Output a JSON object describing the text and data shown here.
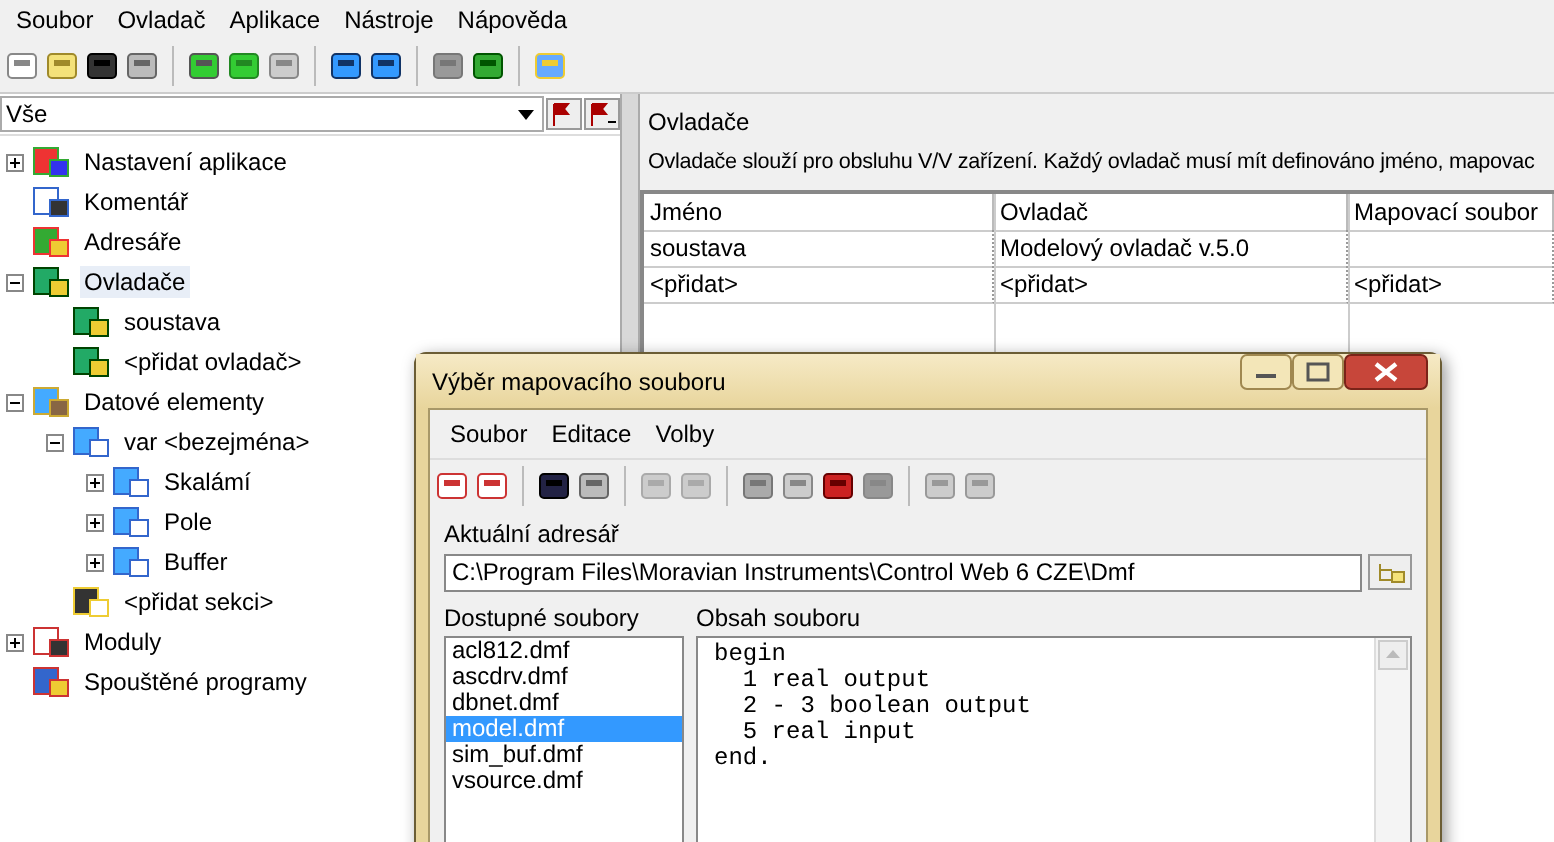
{
  "menu": [
    {
      "label": "Soubor"
    },
    {
      "label": "Ovladač"
    },
    {
      "label": "Aplikace"
    },
    {
      "label": "Nástroje"
    },
    {
      "label": "Nápověda"
    }
  ],
  "filter": {
    "value": "Vše"
  },
  "tree": [
    {
      "label": "Nastavení aplikace",
      "kind": "settings",
      "expanded": false,
      "selected": false
    },
    {
      "label": "Komentář",
      "kind": "comment",
      "selected": false
    },
    {
      "label": "Adresáře",
      "kind": "directories",
      "selected": false
    },
    {
      "label": "Ovladače",
      "kind": "drivers",
      "expanded": true,
      "selected": true,
      "children": [
        {
          "label": "soustava",
          "kind": "drivers",
          "selected": false
        },
        {
          "label": "<přidat ovladač>",
          "kind": "drivers",
          "selected": false
        }
      ]
    },
    {
      "label": "Datové elementy",
      "kind": "data",
      "expanded": true,
      "selected": false,
      "children": [
        {
          "label": "var <bezejména>",
          "kind": "variable",
          "expanded": true,
          "selected": false,
          "children": [
            {
              "label": "Skalámí",
              "kind": "element",
              "expanded": false,
              "selected": false
            },
            {
              "label": "Pole",
              "kind": "element",
              "expanded": false,
              "selected": false
            },
            {
              "label": "Buffer",
              "kind": "element",
              "expanded": false,
              "selected": false
            }
          ]
        },
        {
          "label": "<přidat sekci>",
          "kind": "section",
          "selected": false
        }
      ]
    },
    {
      "label": "Moduly",
      "kind": "modules",
      "expanded": false,
      "selected": false
    },
    {
      "label": "Spouštěné programy",
      "kind": "programs",
      "selected": false
    }
  ],
  "panel": {
    "title": "Ovladače",
    "description": "Ovladače slouží pro obsluhu V/V zařízení. Každý ovladač musí mít definováno jméno, mapovac"
  },
  "table": {
    "columns": [
      "Jméno",
      "Ovladač",
      "Mapovací soubor"
    ],
    "rows": [
      [
        "soustava",
        "Modelový ovladač v.5.0"
      ],
      [
        "<přidat>",
        "<přidat>",
        "<přidat>"
      ]
    ]
  },
  "dialog": {
    "title": "Výběr mapovacího souboru",
    "menu": [
      {
        "label": "Soubor"
      },
      {
        "label": "Editace"
      },
      {
        "label": "Volby"
      }
    ],
    "address_label": "Aktuální adresář",
    "address_value": "C:\\Program Files\\Moravian Instruments\\Control Web 6 CZE\\Dmf",
    "files_label": "Dostupné soubory",
    "files": [
      {
        "name": "acl812.dmf",
        "selected": false
      },
      {
        "name": "ascdrv.dmf",
        "selected": false
      },
      {
        "name": "dbnet.dmf",
        "selected": false
      },
      {
        "name": "model.dmf",
        "selected": true
      },
      {
        "name": "sim_buf.dmf",
        "selected": false
      },
      {
        "name": "vsource.dmf",
        "selected": false
      }
    ],
    "content_label": "Obsah souboru",
    "content_lines": [
      "begin",
      "  1 real output",
      "  2 - 3 boolean output",
      "  5 real input",
      "end."
    ]
  }
}
